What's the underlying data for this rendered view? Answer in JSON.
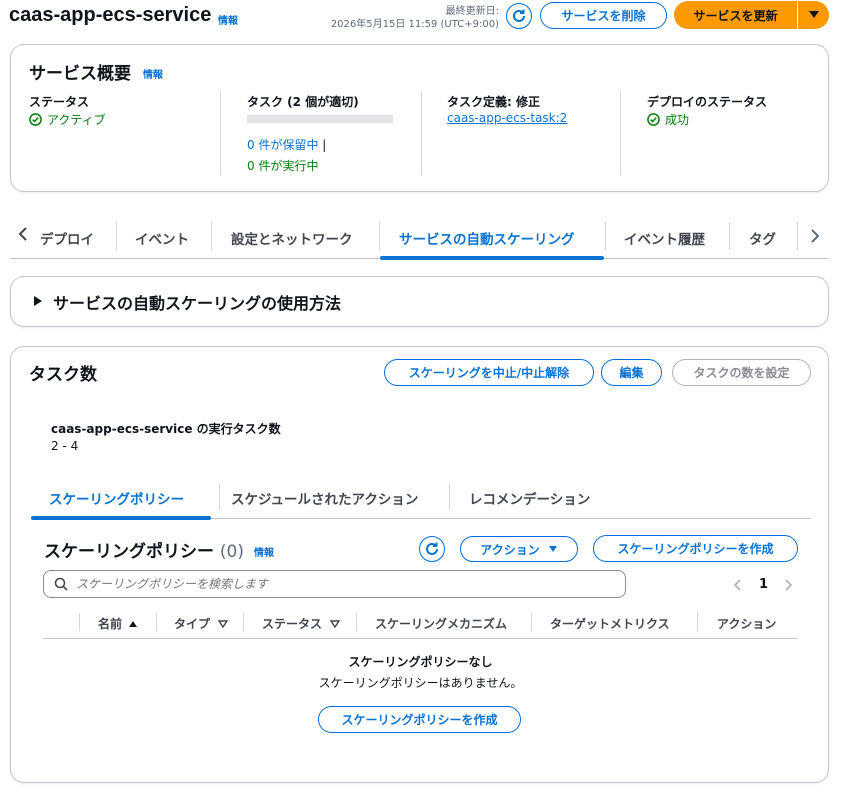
{
  "header": {
    "title": "caas-app-ecs-service",
    "info": "情報",
    "last_updated_label": "最終更新日:",
    "last_updated_value": "2026年5月15日 11:59 (UTC+9:00)",
    "delete_label": "サービスを削除",
    "update_label": "サービスを更新"
  },
  "overview": {
    "title": "サービス概要",
    "info": "情報",
    "status_label": "ステータス",
    "status_value": "アクティブ",
    "tasks_label": "タスク (2 個が適切)",
    "tasks_pending": "0 件が保留中",
    "tasks_pending_sep": "|",
    "tasks_running": "0 件が実行中",
    "taskdef_label": "タスク定義: 修正",
    "taskdef_value": "caas-app-ecs-task:2",
    "deploy_label": "デプロイのステータス",
    "deploy_value": "成功"
  },
  "tabs": {
    "items": [
      "デプロイ",
      "イベント",
      "設定とネットワーク",
      "サービスの自動スケーリング",
      "イベント履歴",
      "タグ"
    ],
    "active_index": 3
  },
  "howto": {
    "title": "サービスの自動スケーリングの使用方法"
  },
  "tasks_panel": {
    "title": "タスク数",
    "suspend_label": "スケーリングを中止/中止解除",
    "edit_label": "編集",
    "set_count_label": "タスクの数を設定",
    "running_label": "caas-app-ecs-service の実行タスク数",
    "running_value": "2 - 4"
  },
  "subtabs": {
    "items": [
      "スケーリングポリシー",
      "スケジュールされたアクション",
      "レコメンデーション"
    ],
    "active_index": 0
  },
  "policies": {
    "title": "スケーリングポリシー",
    "count": "(0)",
    "info": "情報",
    "actions_label": "アクション",
    "create_label": "スケーリングポリシーを作成",
    "search_placeholder": "スケーリングポリシーを検索します",
    "page_number": "1",
    "columns": [
      "名前",
      "タイプ",
      "ステータス",
      "スケーリングメカニズム",
      "ターゲットメトリクス",
      "アクション"
    ],
    "empty_title": "スケーリングポリシーなし",
    "empty_desc": "スケーリングポリシーはありません。",
    "empty_create_label": "スケーリングポリシーを作成"
  },
  "colors": {
    "link": "#0972d3",
    "primary": "#ff9900",
    "success": "#037f0c",
    "border": "#c6c6cd"
  }
}
